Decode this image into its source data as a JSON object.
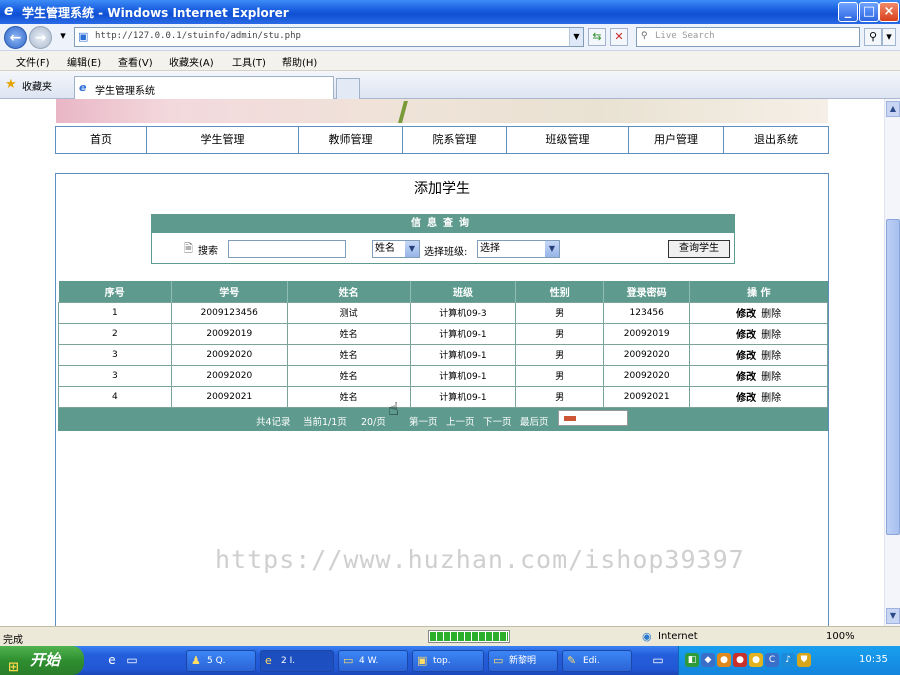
{
  "window": {
    "title": "学生管理系统 - Windows Internet Explorer",
    "min": "_",
    "max": "□",
    "close": "×"
  },
  "browser": {
    "url": "http://127.0.0.1/stuinfo/admin/stu.php",
    "search_placeholder": "Live Search",
    "menu": [
      "文件(F)",
      "编辑(E)",
      "查看(V)",
      "收藏夹(A)",
      "工具(T)",
      "帮助(H)"
    ],
    "favorites_label": "收藏夹",
    "tab_title": "学生管理系统"
  },
  "nav": [
    "首页",
    "学生管理",
    "教师管理",
    "院系管理",
    "班级管理",
    "用户管理",
    "退出系统"
  ],
  "page_title": "添加学生",
  "query": {
    "header": "信息查询",
    "search_label": "搜索",
    "keyword_value": "",
    "field_select": "姓名",
    "class_label": "选择班级:",
    "class_select": "选择",
    "button": "查询学生"
  },
  "table": {
    "headers": [
      "序号",
      "学号",
      "姓名",
      "班级",
      "性别",
      "登录密码",
      "操 作"
    ],
    "rows": [
      [
        "1",
        "2009123456",
        "测试",
        "计算机09-3",
        "男",
        "123456"
      ],
      [
        "2",
        "20092019",
        "姓名",
        "计算机09-1",
        "男",
        "20092019"
      ],
      [
        "3",
        "20092020",
        "姓名",
        "计算机09-1",
        "男",
        "20092020"
      ],
      [
        "3",
        "20092020",
        "姓名",
        "计算机09-1",
        "男",
        "20092020"
      ],
      [
        "4",
        "20092021",
        "姓名",
        "计算机09-1",
        "男",
        "20092021"
      ]
    ],
    "edit_label": "修改",
    "delete_label": "删除"
  },
  "pager": {
    "total": "共4记录",
    "current": "当前1/1页",
    "per_page": "20/页",
    "first": "第一页",
    "prev": "上一页",
    "next": "下一页",
    "last": "最后页"
  },
  "watermark": "https://www.huzhan.com/ishop39397",
  "status": {
    "text": "完成",
    "zone": "Internet",
    "zoom": "100%",
    "progress": 1.0
  },
  "taskbar": {
    "start": "开始",
    "items": [
      "5 Q.",
      "2 I.",
      "4 W.",
      "top.",
      "新黎明",
      "Edi."
    ],
    "clock": "10:35"
  }
}
